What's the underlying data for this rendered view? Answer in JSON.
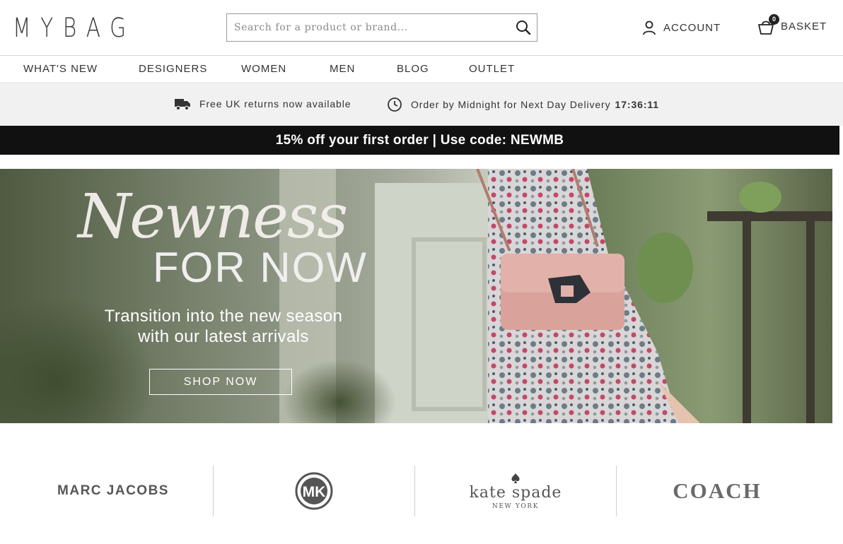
{
  "header": {
    "logo": "MYBAG",
    "search": {
      "placeholder": "Search for a product or brand...",
      "value": ""
    },
    "account_label": "ACCOUNT",
    "basket_label": "BASKET",
    "basket_count": "0"
  },
  "nav": {
    "items": [
      {
        "label": "WHAT'S NEW"
      },
      {
        "label": "DESIGNERS"
      },
      {
        "label": "WOMEN"
      },
      {
        "label": "MEN"
      },
      {
        "label": "BLOG"
      },
      {
        "label": "OUTLET"
      }
    ]
  },
  "info_bar": {
    "returns": "Free UK returns now available",
    "delivery": "Order by Midnight for Next Day Delivery",
    "countdown": "17:36:11"
  },
  "promo": {
    "text": "15% off your first order | Use code: NEWMB"
  },
  "hero": {
    "script": "Newness",
    "title": "FOR NOW",
    "subtitle_line1": "Transition into the new season",
    "subtitle_line2": "with our latest arrivals",
    "button": "SHOP NOW"
  },
  "brands": {
    "marc_jacobs": "MARC JACOBS",
    "michael_kors": "MK",
    "michael_kors_ring": "MICHAEL KORS",
    "kate_spade": "kate spade",
    "kate_spade_city": "NEW YORK",
    "coach": "COACH"
  },
  "colors": {
    "promo_bg": "#111111",
    "info_bg": "#f1f1f1",
    "border": "#d6d6d6",
    "text": "#333333"
  },
  "icons": [
    "search-icon",
    "account-icon",
    "basket-icon",
    "delivery-truck-icon",
    "clock-icon",
    "spade-icon"
  ]
}
